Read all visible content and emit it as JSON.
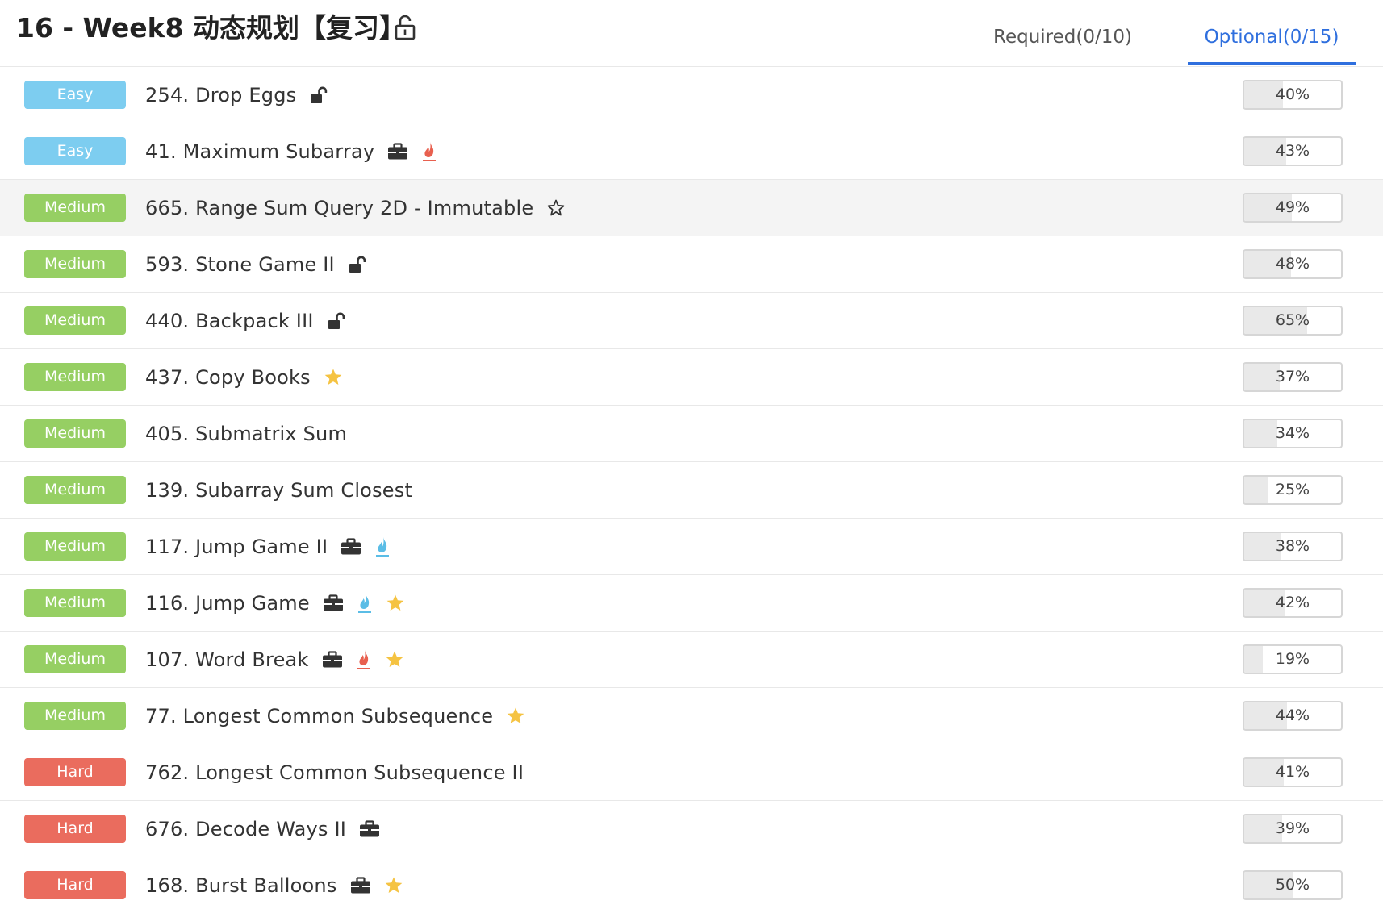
{
  "header": {
    "title": "16 - Week8 动态规划【复习】",
    "title_icon": "unlock-icon",
    "tabs": [
      {
        "label": "Required(0/10)",
        "active": false
      },
      {
        "label": "Optional(0/15)",
        "active": true
      }
    ]
  },
  "colors": {
    "easy": "#7dcdf0",
    "medium": "#96cf63",
    "hard": "#ea6c5e",
    "active_tab": "#2f6fde",
    "hot_red": "#e8604f",
    "hot_blue": "#5bbde6",
    "star_gold": "#f5c342"
  },
  "problems": [
    {
      "difficulty": "Easy",
      "level": "easy",
      "title": "254. Drop Eggs",
      "tags": [
        "unlock-icon"
      ],
      "rate": "40%",
      "rate_value": 0.4,
      "hovered": false
    },
    {
      "difficulty": "Easy",
      "level": "easy",
      "title": "41. Maximum Subarray",
      "tags": [
        "briefcase-icon",
        "flame-red-icon"
      ],
      "rate": "43%",
      "rate_value": 0.43,
      "hovered": false
    },
    {
      "difficulty": "Medium",
      "level": "medium",
      "title": "665. Range Sum Query 2D - Immutable",
      "tags": [
        "star-outline-icon"
      ],
      "rate": "49%",
      "rate_value": 0.49,
      "hovered": true
    },
    {
      "difficulty": "Medium",
      "level": "medium",
      "title": "593. Stone Game II",
      "tags": [
        "unlock-icon"
      ],
      "rate": "48%",
      "rate_value": 0.48,
      "hovered": false
    },
    {
      "difficulty": "Medium",
      "level": "medium",
      "title": "440. Backpack III",
      "tags": [
        "unlock-icon"
      ],
      "rate": "65%",
      "rate_value": 0.65,
      "hovered": false
    },
    {
      "difficulty": "Medium",
      "level": "medium",
      "title": "437. Copy Books",
      "tags": [
        "star-filled-icon"
      ],
      "rate": "37%",
      "rate_value": 0.37,
      "hovered": false
    },
    {
      "difficulty": "Medium",
      "level": "medium",
      "title": "405. Submatrix Sum",
      "tags": [],
      "rate": "34%",
      "rate_value": 0.34,
      "hovered": false
    },
    {
      "difficulty": "Medium",
      "level": "medium",
      "title": "139. Subarray Sum Closest",
      "tags": [],
      "rate": "25%",
      "rate_value": 0.25,
      "hovered": false
    },
    {
      "difficulty": "Medium",
      "level": "medium",
      "title": "117. Jump Game II",
      "tags": [
        "briefcase-icon",
        "flame-blue-icon"
      ],
      "rate": "38%",
      "rate_value": 0.38,
      "hovered": false
    },
    {
      "difficulty": "Medium",
      "level": "medium",
      "title": "116. Jump Game",
      "tags": [
        "briefcase-icon",
        "flame-blue-icon",
        "star-filled-icon"
      ],
      "rate": "42%",
      "rate_value": 0.42,
      "hovered": false
    },
    {
      "difficulty": "Medium",
      "level": "medium",
      "title": "107. Word Break",
      "tags": [
        "briefcase-icon",
        "flame-red-icon",
        "star-filled-icon"
      ],
      "rate": "19%",
      "rate_value": 0.19,
      "hovered": false
    },
    {
      "difficulty": "Medium",
      "level": "medium",
      "title": "77. Longest Common Subsequence",
      "tags": [
        "star-filled-icon"
      ],
      "rate": "44%",
      "rate_value": 0.44,
      "hovered": false
    },
    {
      "difficulty": "Hard",
      "level": "hard",
      "title": "762. Longest Common Subsequence II",
      "tags": [],
      "rate": "41%",
      "rate_value": 0.41,
      "hovered": false
    },
    {
      "difficulty": "Hard",
      "level": "hard",
      "title": "676. Decode Ways II",
      "tags": [
        "briefcase-icon"
      ],
      "rate": "39%",
      "rate_value": 0.39,
      "hovered": false
    },
    {
      "difficulty": "Hard",
      "level": "hard",
      "title": "168. Burst Balloons",
      "tags": [
        "briefcase-icon",
        "star-filled-icon"
      ],
      "rate": "50%",
      "rate_value": 0.5,
      "hovered": false
    }
  ]
}
